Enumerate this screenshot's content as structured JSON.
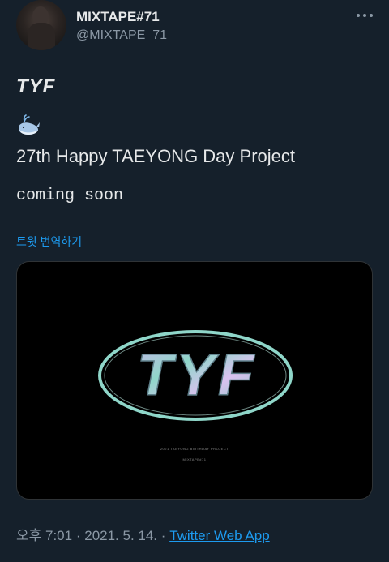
{
  "author": {
    "display_name": "MIXTAPE#71",
    "handle": "@MIXTAPE_71",
    "avatar_icon": "profile-photo"
  },
  "tweet": {
    "line1": "TYF",
    "emoji_icon": "spouting-whale-emoji",
    "line3": "27th Happy TAEYONG Day Project",
    "line4": "coming soon"
  },
  "translate_link": "트윗 번역하기",
  "media": {
    "logo_text": "TYF",
    "subtitle": "2021 TAEYONG BIRTHDAY PROJECT",
    "credit": "MIXTAPE#71"
  },
  "meta": {
    "time": "오후 7:01",
    "separator": "·",
    "date": "2021. 5. 14.",
    "app": "Twitter Web App"
  },
  "colors": {
    "background": "#15202b",
    "link": "#1d9bf0",
    "secondary_text": "#8b98a5"
  }
}
